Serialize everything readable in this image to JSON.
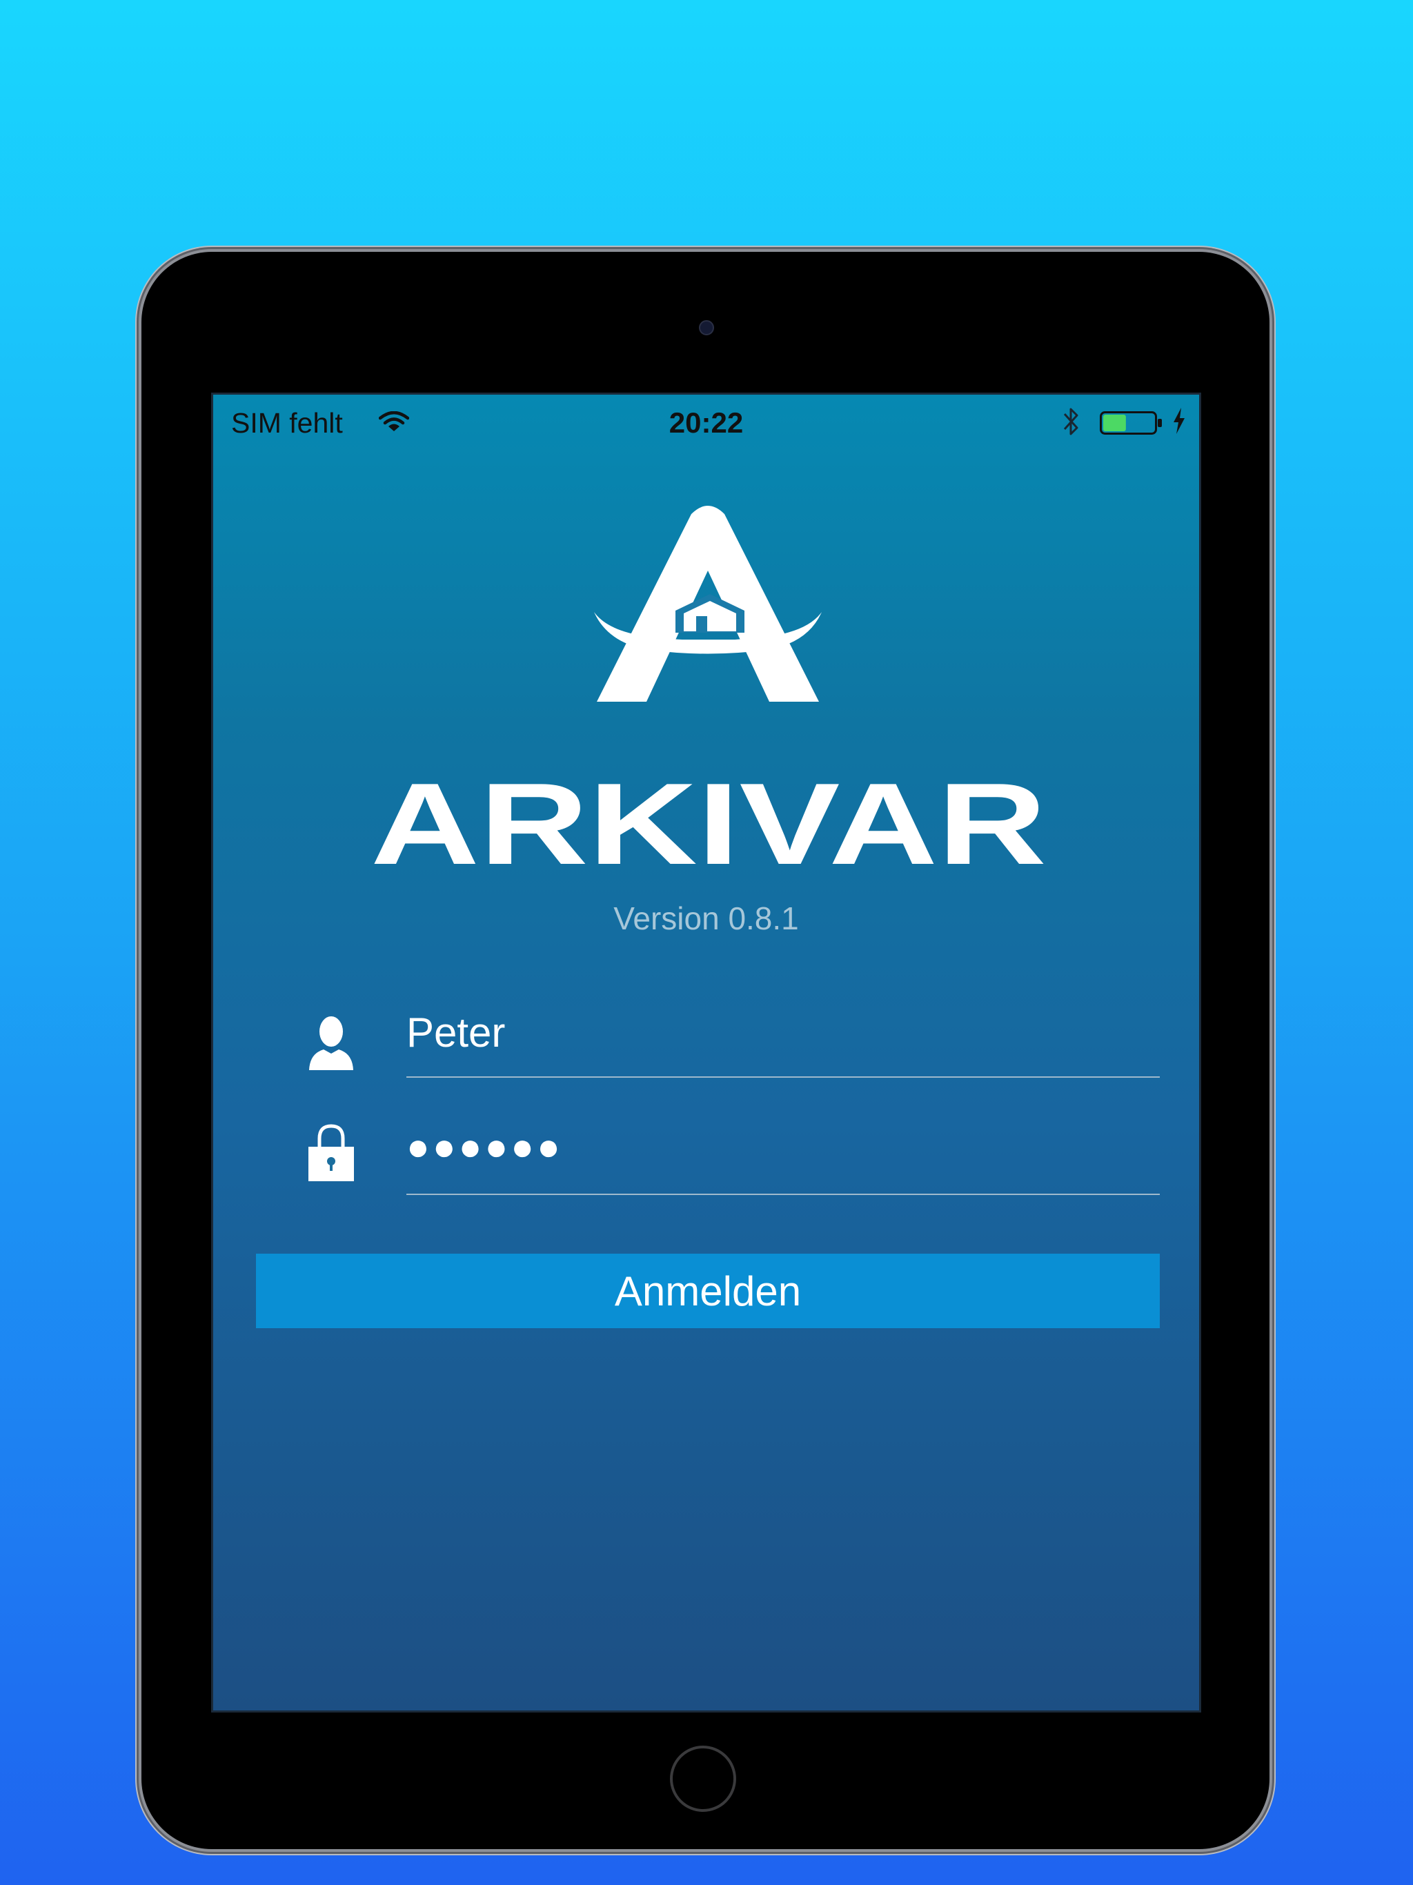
{
  "status_bar": {
    "carrier": "SIM fehlt",
    "time": "20:22",
    "battery_level": 0.45,
    "battery_color": "#4cd964"
  },
  "app": {
    "name": "ARKIVAR",
    "version": "Version 0.8.1"
  },
  "login": {
    "username_value": "Peter",
    "password_value": "●●●●●●",
    "submit_label": "Anmelden"
  },
  "colors": {
    "background_top": "#19d6fe",
    "background_bottom": "#1f63f0",
    "screen_top": "#0689b2",
    "screen_bottom": "#1c4f84",
    "button": "#0a8fd4"
  },
  "icons": [
    "wifi-icon",
    "bluetooth-icon",
    "battery-icon",
    "charging-icon",
    "user-icon",
    "lock-icon"
  ]
}
